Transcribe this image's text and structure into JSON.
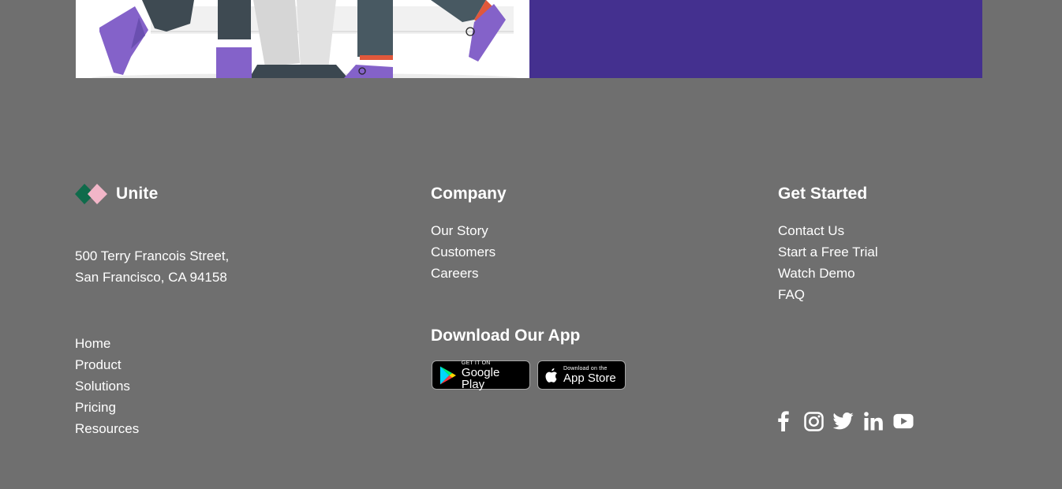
{
  "brand": {
    "name": "Unite"
  },
  "address": {
    "line1": "500 Terry Francois Street,",
    "line2": "San Francisco, CA 94158"
  },
  "nav": {
    "items": [
      "Home",
      "Product",
      "Solutions",
      "Pricing",
      "Resources"
    ]
  },
  "company": {
    "title": "Company",
    "items": [
      "Our Story",
      "Customers",
      "Careers"
    ]
  },
  "get_started": {
    "title": "Get Started",
    "items": [
      "Contact Us",
      "Start a Free Trial",
      "Watch Demo",
      "FAQ"
    ]
  },
  "app": {
    "title": "Download Our App",
    "google": {
      "small": "GET IT ON",
      "big": "Google Play"
    },
    "apple": {
      "small": "Download on the",
      "big": "App Store"
    }
  },
  "social": [
    "facebook-icon",
    "instagram-icon",
    "twitter-icon",
    "linkedin-icon",
    "youtube-icon"
  ],
  "colors": {
    "background": "#6f6f6f",
    "hero_panel": "#44308f",
    "accent_purple": "#8462c9",
    "logo_green": "#0f6b4b",
    "logo_pink": "#f2b6c8"
  }
}
